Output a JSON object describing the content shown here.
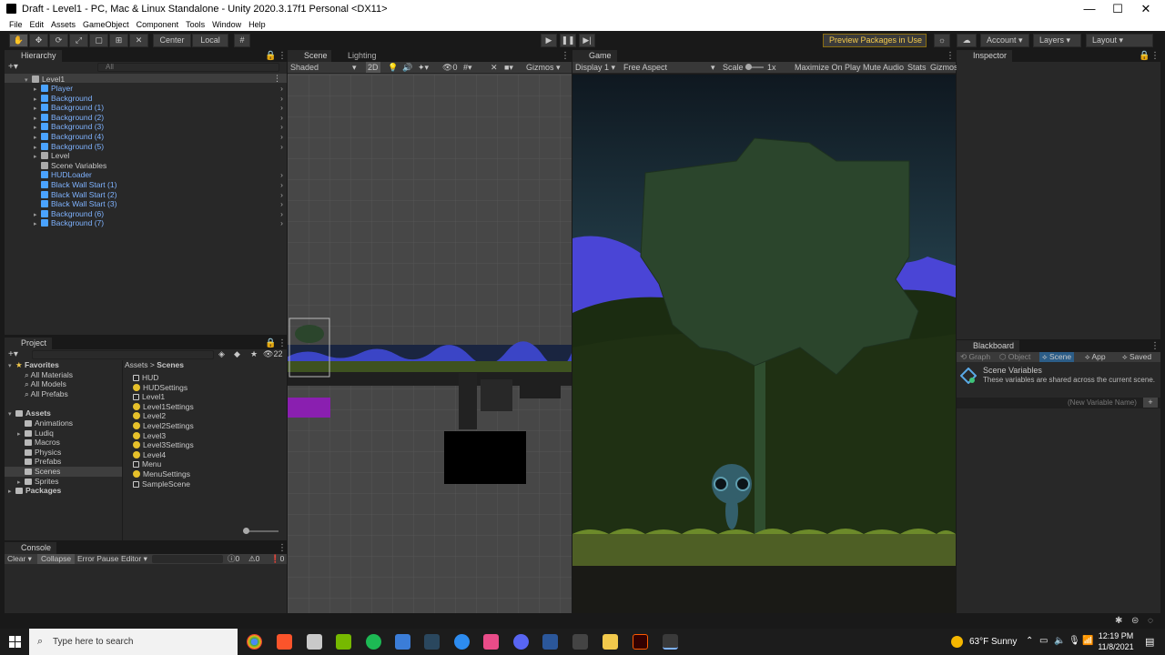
{
  "window": {
    "title": "Draft - Level1 - PC, Mac & Linux Standalone - Unity 2020.3.17f1 Personal <DX11>",
    "minimize": "—",
    "maximize": "☐",
    "close": "✕"
  },
  "menu": [
    "File",
    "Edit",
    "Assets",
    "GameObject",
    "Component",
    "Tools",
    "Window",
    "Help"
  ],
  "toolbar": {
    "center": "Center",
    "local": "Local",
    "preview_packages": "Preview Packages in Use",
    "account": "Account",
    "layers": "Layers",
    "layout": "Layout"
  },
  "hierarchy": {
    "tab": "Hierarchy",
    "search_placeholder": "All",
    "root": "Level1",
    "items": [
      {
        "label": "Player",
        "prefab": true,
        "expandable": true
      },
      {
        "label": "Background",
        "prefab": true,
        "expandable": true
      },
      {
        "label": "Background (1)",
        "prefab": true,
        "expandable": true
      },
      {
        "label": "Background (2)",
        "prefab": true,
        "expandable": true
      },
      {
        "label": "Background (3)",
        "prefab": true,
        "expandable": true
      },
      {
        "label": "Background (4)",
        "prefab": true,
        "expandable": true
      },
      {
        "label": "Background (5)",
        "prefab": true,
        "expandable": true
      },
      {
        "label": "Level",
        "prefab": false,
        "expandable": true
      },
      {
        "label": "Scene Variables",
        "prefab": false,
        "expandable": false
      },
      {
        "label": "HUDLoader",
        "prefab": true,
        "expandable": false
      },
      {
        "label": "Black Wall Start (1)",
        "prefab": true,
        "expandable": false
      },
      {
        "label": "Black Wall Start (2)",
        "prefab": true,
        "expandable": false
      },
      {
        "label": "Black Wall Start (3)",
        "prefab": true,
        "expandable": false
      },
      {
        "label": "Background (6)",
        "prefab": true,
        "expandable": true
      },
      {
        "label": "Background (7)",
        "prefab": true,
        "expandable": true
      }
    ]
  },
  "project": {
    "tab": "Project",
    "hidden_count": "22",
    "breadcrumb": [
      "Assets",
      "Scenes"
    ],
    "favorites": {
      "label": "Favorites",
      "items": [
        "All Materials",
        "All Models",
        "All Prefabs"
      ]
    },
    "assets": {
      "label": "Assets",
      "items": [
        "Animations",
        "Ludiq",
        "Macros",
        "Physics",
        "Prefabs",
        "Scenes",
        "Sprites"
      ]
    },
    "packages": "Packages",
    "files": [
      {
        "label": "HUD",
        "kind": "scene"
      },
      {
        "label": "HUDSettings",
        "kind": "settings"
      },
      {
        "label": "Level1",
        "kind": "scene"
      },
      {
        "label": "Level1Settings",
        "kind": "settings"
      },
      {
        "label": "Level2",
        "kind": "settings"
      },
      {
        "label": "Level2Settings",
        "kind": "settings"
      },
      {
        "label": "Level3",
        "kind": "settings"
      },
      {
        "label": "Level3Settings",
        "kind": "settings"
      },
      {
        "label": "Level4",
        "kind": "settings"
      },
      {
        "label": "Menu",
        "kind": "scene"
      },
      {
        "label": "MenuSettings",
        "kind": "settings"
      },
      {
        "label": "SampleScene",
        "kind": "scene"
      }
    ]
  },
  "console": {
    "tab": "Console",
    "clear": "Clear",
    "collapse": "Collapse",
    "error_pause": "Error Pause",
    "editor": "Editor",
    "warn_count": "0",
    "msg_count": "0",
    "err_count": "0"
  },
  "scene": {
    "tab": "Scene",
    "lighting_tab": "Lighting",
    "shading": "Shaded",
    "mode_2d": "2D",
    "fx_count": "0",
    "gizmos": "Gizmos"
  },
  "game": {
    "tab": "Game",
    "display": "Display 1",
    "aspect": "Free Aspect",
    "scale_label": "Scale",
    "scale_value": "1x",
    "maximize": "Maximize On Play",
    "mute": "Mute Audio",
    "stats": "Stats",
    "gizmos": "Gizmos"
  },
  "inspector": {
    "tab": "Inspector"
  },
  "blackboard": {
    "tab": "Blackboard",
    "tabs": [
      "Graph",
      "Object",
      "Scene",
      "App",
      "Saved"
    ],
    "active_tab": "Scene",
    "title": "Scene Variables",
    "description": "These variables are shared across the current scene.",
    "new_var_placeholder": "(New Variable Name)",
    "add": "+"
  },
  "taskbar": {
    "search_placeholder": "Type here to search",
    "weather": "63°F  Sunny",
    "time": "12:19 PM",
    "date": "11/8/2021"
  },
  "colors": {
    "editor_bg": "#282828",
    "prefab_blue": "#7fb3ff",
    "selection": "#2c5d87",
    "sky_top": "#0f1820",
    "sky_bottom": "#24404c",
    "mountain": "#4a45d6",
    "hill": "#1a2a10",
    "tree": "#2b452c",
    "ground": "#7c9a30",
    "purple_block": "#8a1fb0"
  }
}
